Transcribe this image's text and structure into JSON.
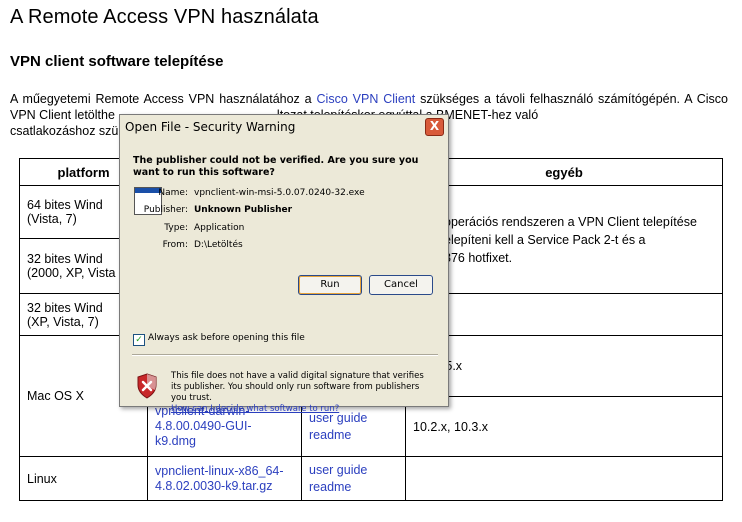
{
  "page": {
    "title": "A Remote Access VPN használata",
    "subtitle": "VPN client software telepítése",
    "para_1": "A műegyetemi Remote Access VPN használatához a ",
    "para_link": "Cisco VPN Client",
    "para_2": " szükséges a távoli felhasználó számítógépén. A Cisco VPN Client letölthe",
    "para_3": "ltozat telepítéskor egyúttal a BMENET-hez való",
    "para_4": "csatlakozáshoz szü"
  },
  "table": {
    "headers": {
      "platform": "platform",
      "etc": "egyéb"
    },
    "rows": {
      "r1_platform": "64 bites Wind\n(Vista, 7)",
      "r2_platform": "32 bites Wind\n(2000, XP, Vista",
      "r2_etc_1": "operációs rendszeren a VPN Client telepítése",
      "r2_etc_2": "elepíteni kell a Service Pack 2-t és a",
      "r2_etc_3": "876 hotfixet.",
      "r3_platform": "32 bites Wind\n(XP, Vista, 7)",
      "mac_platform": "Mac OS X",
      "mac1_etc": "10.5.x",
      "mac2_file": "vpnclient-darwin-\n4.8.00.0490-GUI-\nk9.dmg",
      "mac2_doc_1": "user guide",
      "mac2_doc_2": "readme",
      "mac2_etc": "10.2.x, 10.3.x",
      "linux_platform": "Linux",
      "linux_file": "vpnclient-linux-x86_64-\n4.8.02.0030-k9.tar.gz",
      "linux_doc_1": "user guide",
      "linux_doc_2": "readme"
    }
  },
  "dialog": {
    "title": "Open File - Security Warning",
    "close": "X",
    "question": "The publisher could not be verified.  Are you sure you want to run this software?",
    "name_label": "Name:",
    "name_value": "vpnclient-win-msi-5.0.07.0240-32.exe",
    "publisher_label": "Publisher:",
    "publisher_value": "Unknown Publisher",
    "type_label": "Type:",
    "type_value": "Application",
    "from_label": "From:",
    "from_value": "D:\\Letöltés",
    "run_label": "Run",
    "cancel_label": "Cancel",
    "checkbox_label": "Always ask before opening this file",
    "checkbox_mark": "✓",
    "warning_text": "This file does not have a valid digital signature that verifies its publisher.  You should only run software from publishers you trust.",
    "help_link": "How can I decide what software to run?"
  },
  "colors": {
    "link": "#2b3fbf",
    "dialog_bg": "#ece9d8",
    "close_red": "#d85a3a"
  }
}
